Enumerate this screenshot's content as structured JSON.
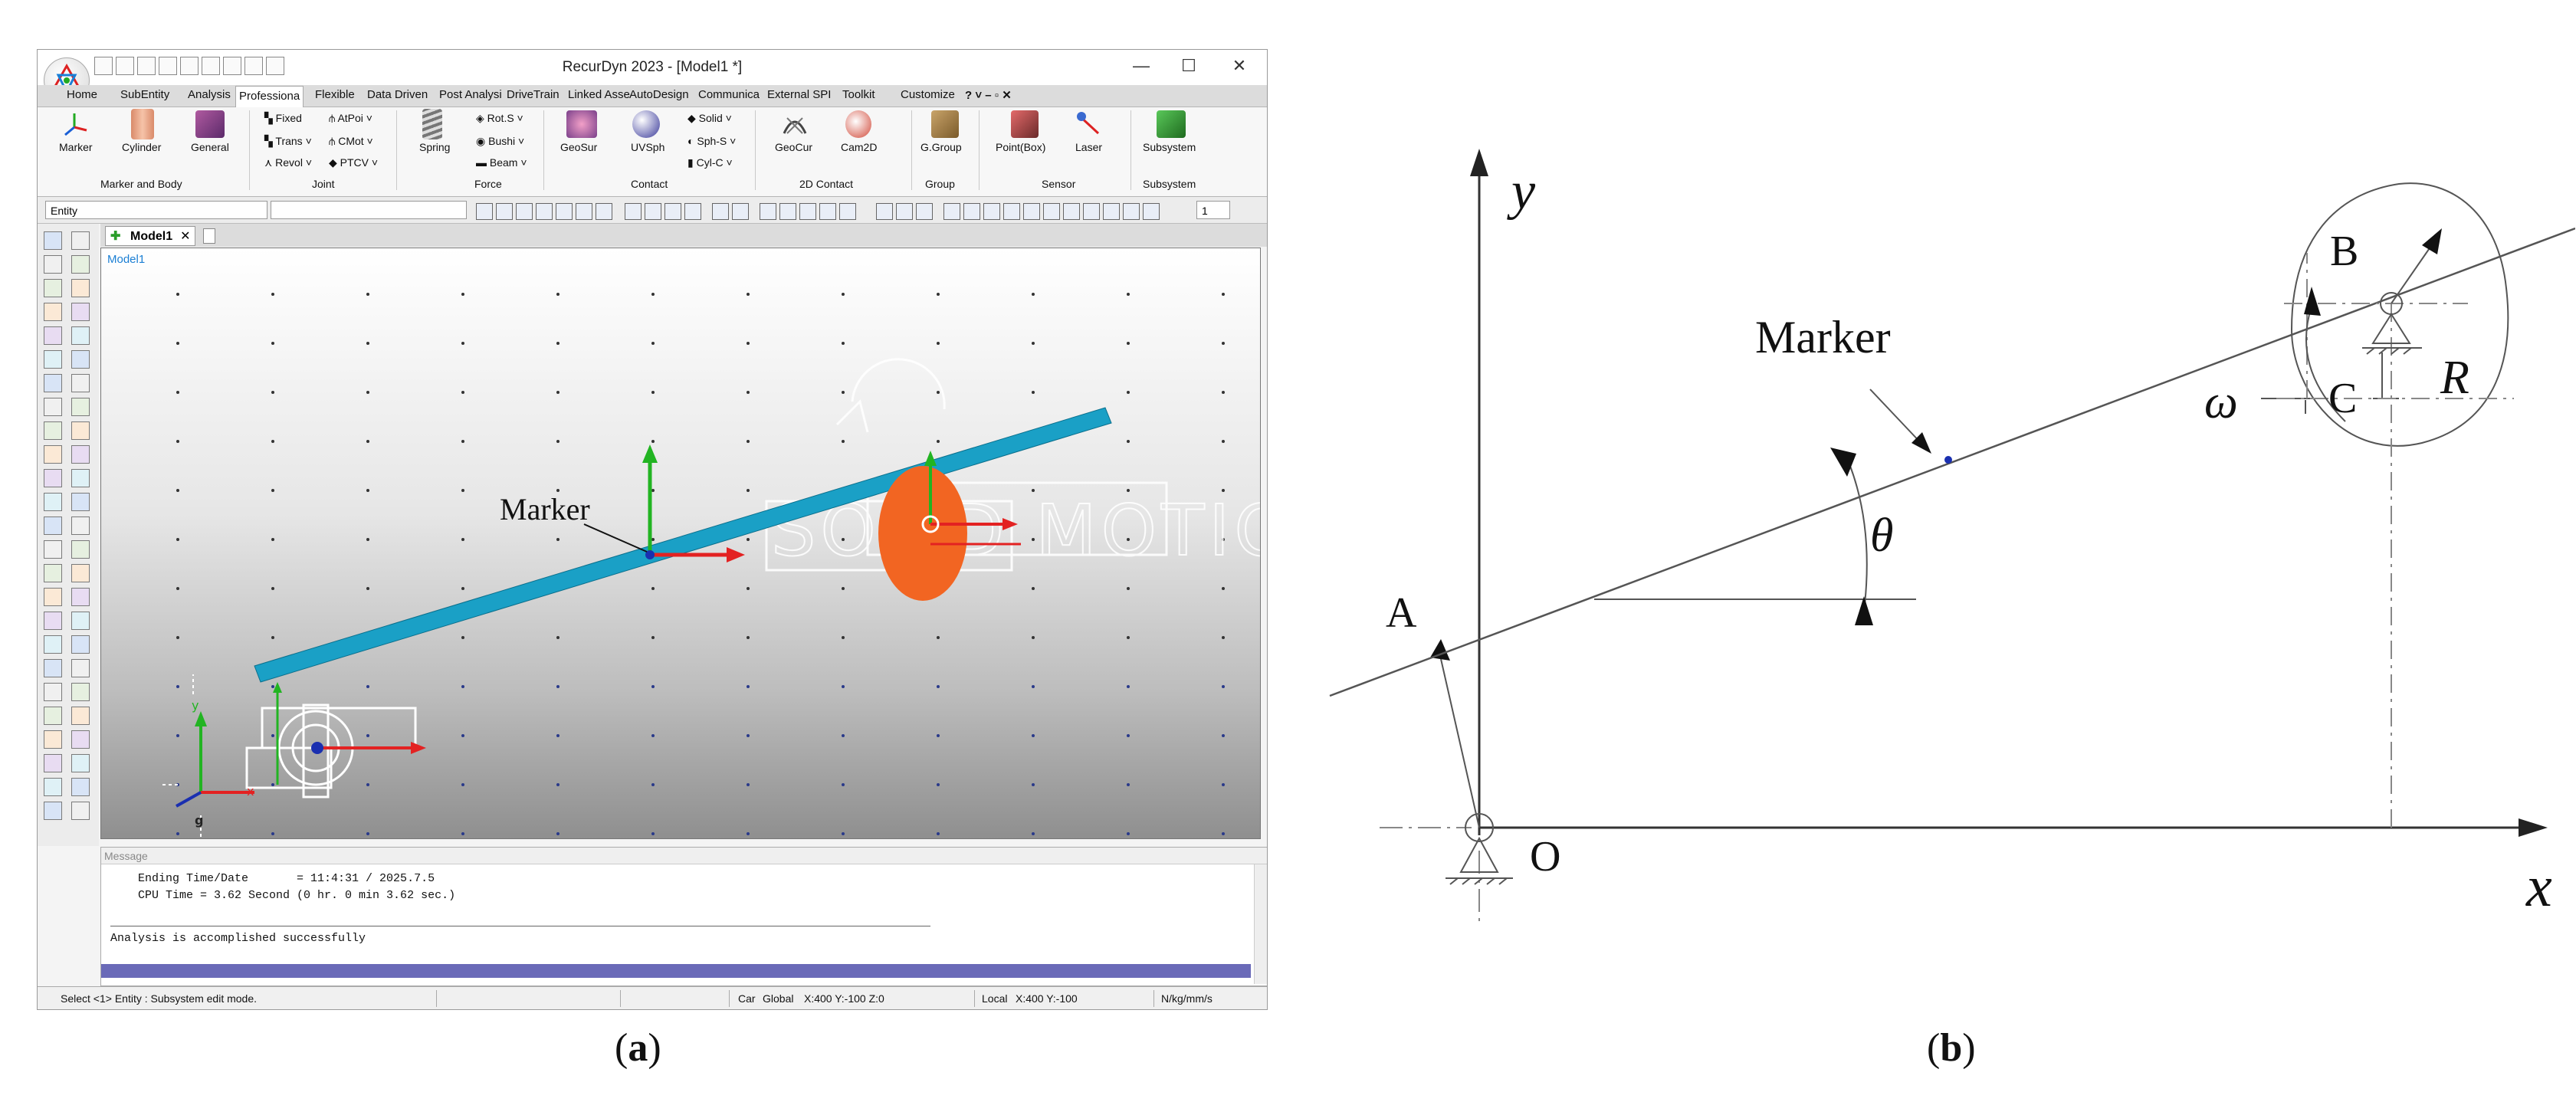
{
  "panel_a": {
    "caption": "a",
    "window": {
      "title": "RecurDyn 2023  - [Model1 *]",
      "controls": {
        "minimize": "—",
        "maximize": "☐",
        "close": "✕"
      }
    },
    "menu_tabs": [
      "Home",
      "SubEntity",
      "Analysis",
      "Professiona",
      "Flexible",
      "Data Driven",
      "Post Analysi",
      "DriveTrain",
      "Linked Asse",
      "AutoDesign",
      "Communica",
      "External SPI",
      "Toolkit",
      "Customize"
    ],
    "ribbon": {
      "marker_body": {
        "items": [
          "Marker",
          "Cylinder",
          "General"
        ],
        "group": "Marker and Body"
      },
      "joint": {
        "items": [
          "Fixed",
          "AtPoi",
          "Trans",
          "CMot",
          "Revol",
          "PTCV"
        ],
        "group": "Joint"
      },
      "force": {
        "items": [
          "Spring",
          "Rot.S",
          "Bushi",
          "Beam"
        ],
        "group": "Force"
      },
      "contact": {
        "items": [
          "GeoSur",
          "UVSph",
          "Solid",
          "Sph-S",
          "Cyl-C"
        ],
        "group": "Contact"
      },
      "contact2d": {
        "items": [
          "GeoCur",
          "Cam2D"
        ],
        "group": "2D Contact"
      },
      "group": {
        "items": [
          "G.Group"
        ],
        "group": "Group"
      },
      "sensor": {
        "items": [
          "Point(Box)",
          "Laser"
        ],
        "group": "Sensor"
      },
      "subsystem": {
        "items": [
          "Subsystem"
        ],
        "group": "Subsystem"
      }
    },
    "toolbar": {
      "entity_combo": "Entity",
      "count_combo": "1"
    },
    "doc_tab": "Model1",
    "viewport": {
      "label": "Model1",
      "marker_label": "Marker",
      "axis_labels": {
        "y": "y",
        "x": "x",
        "g": "g"
      },
      "watermark": "SOLID MOTION"
    },
    "message": {
      "header": "Message",
      "lines": [
        "    Ending Time/Date       = 11:4:31 / 2025.7.5",
        "    CPU Time = 3.62 Second (0 hr. 0 min 3.62 sec.)",
        "Analysis is accomplished successfully"
      ]
    },
    "status": {
      "text": "Select <1> Entity : Subsystem edit mode.",
      "car": "Car",
      "global": "Global",
      "global_coords": "X:400 Y:-100 Z:0",
      "local": "Local",
      "local_coords": "X:400 Y:-100",
      "units": "N/kg/mm/s"
    },
    "colors": {
      "beam": "#1aa0c6",
      "cam": "#f26522",
      "axis_y": "#22b422",
      "axis_x": "#e32222"
    }
  },
  "panel_b": {
    "caption": "b",
    "labels": {
      "y": "y",
      "x": "x",
      "origin": "O",
      "A": "A",
      "B": "B",
      "C": "C",
      "R": "R",
      "omega": "ω",
      "theta": "θ",
      "marker": "Marker"
    },
    "colors": {
      "marker_dot": "#1a2fb0",
      "lines": "#555555"
    }
  }
}
